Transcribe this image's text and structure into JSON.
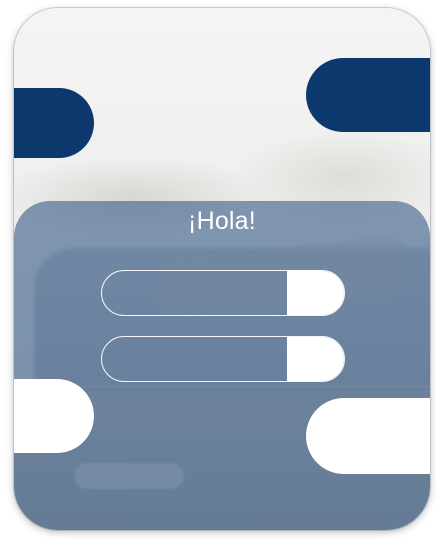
{
  "login": {
    "greeting": "¡Hola!",
    "username_field": {
      "value": "",
      "placeholder": ""
    },
    "password_field": {
      "value": "",
      "placeholder": ""
    }
  },
  "colors": {
    "navy": "#0c386e",
    "panel": "#3c5f8a",
    "white": "#ffffff"
  }
}
